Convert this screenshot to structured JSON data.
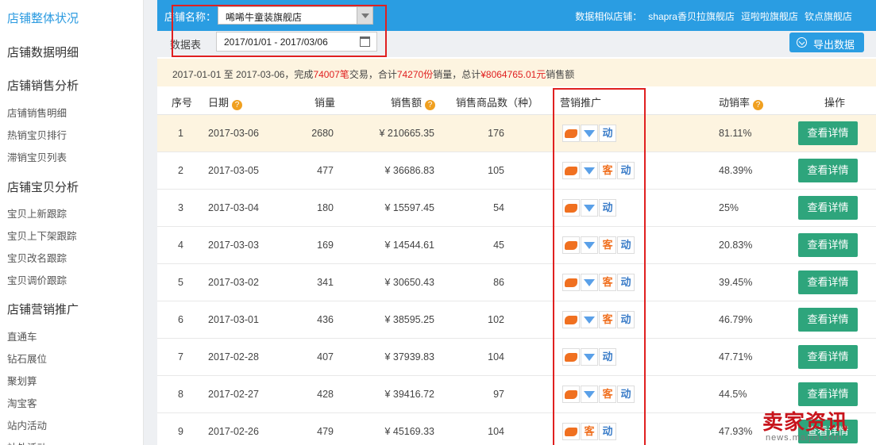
{
  "sidebar": {
    "sections": [
      {
        "title": "店铺整体状况",
        "active": true,
        "items": []
      },
      {
        "title": "店铺数据明细",
        "items": []
      },
      {
        "title": "店铺销售分析",
        "items": [
          "店铺销售明细",
          "热销宝贝排行",
          "滞销宝贝列表"
        ]
      },
      {
        "title": "店铺宝贝分析",
        "items": [
          "宝贝上新跟踪",
          "宝贝上下架跟踪",
          "宝贝改名跟踪",
          "宝贝调价跟踪"
        ]
      },
      {
        "title": "店铺营销推广",
        "items": [
          "直通车",
          "钻石展位",
          "聚划算",
          "淘宝客",
          "站内活动",
          "站外活动"
        ]
      }
    ]
  },
  "topbar": {
    "shop_label": "店铺名称：",
    "shop_value": "唏唏牛童装旗舰店",
    "similar_label": "数据相似店铺：",
    "similar_shops": [
      "shapra香贝拉旗舰店",
      "逗啦啦旗舰店",
      "钦点旗舰店"
    ]
  },
  "filter": {
    "date_label": "数据表",
    "date_range": "2017/01/01 - 2017/03/06",
    "export_label": "导出数据"
  },
  "summary": {
    "p1": "2017-01-01 至 2017-03-06，完成",
    "orders": "74007笔",
    "p2": "交易，合计",
    "qty": "74270份",
    "p3": "销量，总计",
    "total": "¥8064765.01元",
    "p4": "销售额"
  },
  "table": {
    "headers": {
      "idx": "序号",
      "date": "日期",
      "qty": "销量",
      "amount": "销售额",
      "count": "销售商品数（种）",
      "promo": "营销推广",
      "rate": "动销率",
      "action": "操作"
    },
    "rows": [
      {
        "idx": "1",
        "date": "2017-03-06",
        "qty": "2680",
        "amount": "¥ 210665.35",
        "count": "176",
        "promo": [
          "ztc",
          "zs",
          "dong"
        ],
        "rate": "81.11%",
        "action": "查看详情"
      },
      {
        "idx": "2",
        "date": "2017-03-05",
        "qty": "477",
        "amount": "¥ 36686.83",
        "count": "105",
        "promo": [
          "ztc",
          "zs",
          "ke",
          "dong"
        ],
        "rate": "48.39%",
        "action": "查看详情"
      },
      {
        "idx": "3",
        "date": "2017-03-04",
        "qty": "180",
        "amount": "¥ 15597.45",
        "count": "54",
        "promo": [
          "ztc",
          "zs",
          "dong"
        ],
        "rate": "25%",
        "action": "查看详情"
      },
      {
        "idx": "4",
        "date": "2017-03-03",
        "qty": "169",
        "amount": "¥ 14544.61",
        "count": "45",
        "promo": [
          "ztc",
          "zs",
          "ke",
          "dong"
        ],
        "rate": "20.83%",
        "action": "查看详情"
      },
      {
        "idx": "5",
        "date": "2017-03-02",
        "qty": "341",
        "amount": "¥ 30650.43",
        "count": "86",
        "promo": [
          "ztc",
          "zs",
          "ke",
          "dong"
        ],
        "rate": "39.45%",
        "action": "查看详情"
      },
      {
        "idx": "6",
        "date": "2017-03-01",
        "qty": "436",
        "amount": "¥ 38595.25",
        "count": "102",
        "promo": [
          "ztc",
          "zs",
          "ke",
          "dong"
        ],
        "rate": "46.79%",
        "action": "查看详情"
      },
      {
        "idx": "7",
        "date": "2017-02-28",
        "qty": "407",
        "amount": "¥ 37939.83",
        "count": "104",
        "promo": [
          "ztc",
          "zs",
          "dong"
        ],
        "rate": "47.71%",
        "action": "查看详情"
      },
      {
        "idx": "8",
        "date": "2017-02-27",
        "qty": "428",
        "amount": "¥ 39416.72",
        "count": "97",
        "promo": [
          "ztc",
          "zs",
          "ke",
          "dong"
        ],
        "rate": "44.5%",
        "action": "查看详情"
      },
      {
        "idx": "9",
        "date": "2017-02-26",
        "qty": "479",
        "amount": "¥ 45169.33",
        "count": "104",
        "promo": [
          "ztc",
          "ke",
          "dong"
        ],
        "rate": "47.93%",
        "action": "查看详情"
      }
    ],
    "promo_icons": {
      "ztc": "car-icon",
      "zs": "diamond-icon",
      "ke": "客",
      "dong": "动"
    }
  },
  "watermark": {
    "main": "卖家资讯",
    "sub": "news.maijia.com"
  },
  "colors": {
    "accent": "#2a9de2",
    "detail_button": "#2ea57c",
    "highlight": "#e02020",
    "summary_bg": "#fdf4e0"
  }
}
